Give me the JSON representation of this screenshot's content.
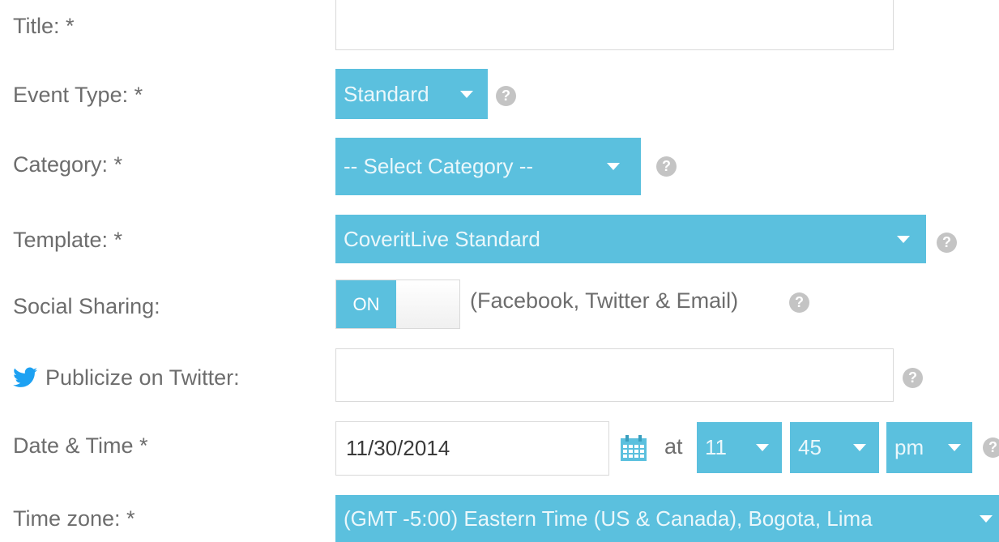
{
  "form": {
    "title": {
      "label": "Title: *",
      "value": ""
    },
    "event_type": {
      "label": "Event Type: *",
      "selected": "Standard",
      "help": "?"
    },
    "category": {
      "label": "Category: *",
      "selected": "-- Select Category --",
      "help": "?"
    },
    "template": {
      "label": "Template: *",
      "selected": "CoveritLive Standard",
      "help": "?"
    },
    "social_sharing": {
      "label": "Social Sharing:",
      "toggle_state": "ON",
      "note": "(Facebook, Twitter & Email)",
      "help": "?"
    },
    "twitter": {
      "label": "Publicize on Twitter:",
      "icon": "twitter-bird-icon",
      "value": "",
      "help": "?"
    },
    "date_time": {
      "label": "Date & Time *",
      "date_value": "11/30/2014",
      "at_text": "at",
      "hour": "11",
      "minute": "45",
      "ampm": "pm",
      "calendar_icon": "calendar-icon",
      "help": "?"
    },
    "time_zone": {
      "label": "Time zone: *",
      "selected": "(GMT -5:00) Eastern Time (US & Canada), Bogota, Lima"
    }
  },
  "colors": {
    "accent": "#5bc0de",
    "help": "#c4c4c4",
    "twitter": "#1da1f2",
    "label": "#6d6d6d"
  }
}
